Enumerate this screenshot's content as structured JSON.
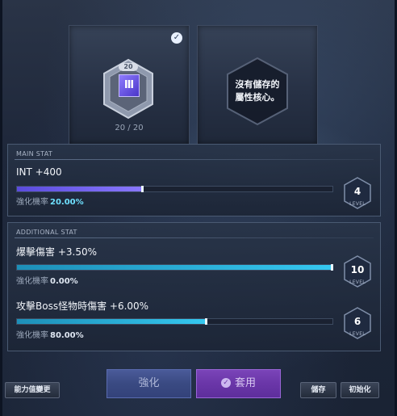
{
  "core_card": {
    "level": "20",
    "numeral": "Ⅲ",
    "count": "20 / 20",
    "selected_icon": "check-icon"
  },
  "empty_card": {
    "line1": "沒有儲存的",
    "line2": "屬性核心。"
  },
  "main_stat": {
    "title": "MAIN STAT",
    "name": "INT +400",
    "rate_label": "強化機率",
    "rate_value": "20.00%",
    "progress": 0.4,
    "level": "4",
    "level_label": "LEVEL"
  },
  "additional_stat": {
    "title": "ADDITIONAL STAT",
    "items": [
      {
        "name": "爆擊傷害 +3.50%",
        "rate_label": "強化機率",
        "rate_value": "0.00%",
        "progress": 1.0,
        "level": "10",
        "level_label": "LEVEL"
      },
      {
        "name": "攻擊Boss怪物時傷害 +6.00%",
        "rate_label": "強化機率",
        "rate_value": "80.00%",
        "progress": 0.6,
        "level": "6",
        "level_label": "LEVEL"
      }
    ]
  },
  "buttons": {
    "ability": "能力值變更",
    "reinforce": "強化",
    "apply": "套用",
    "save": "儲存",
    "reset": "初始化"
  },
  "colors": {
    "main_bar": "#6a5cf0",
    "add_bar": "#2fb8e6",
    "apply_button": "#6a36a8",
    "reinforce_button": "#3a4a82"
  }
}
